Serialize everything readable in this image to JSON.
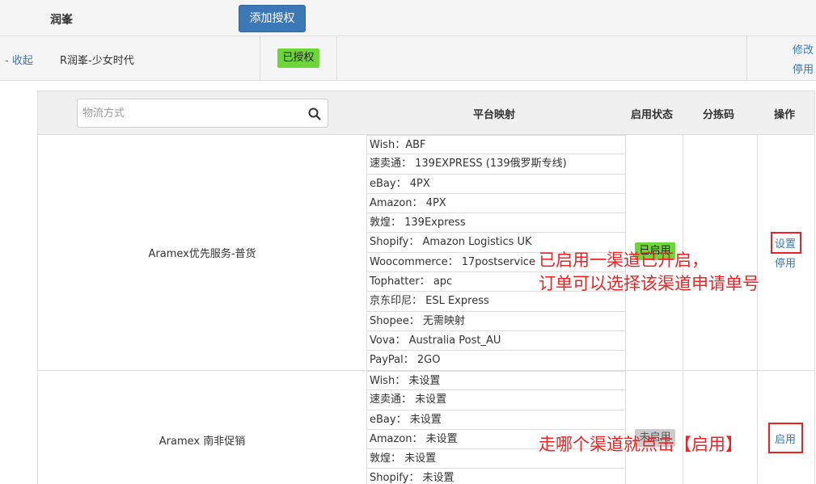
{
  "header": {
    "title": "润峯",
    "add_auth_button": "添加授权"
  },
  "account": {
    "collapse": "- 收起",
    "name": "R润峯-少女时代",
    "status": "已授权",
    "actions": [
      "修改",
      "停用"
    ]
  },
  "table": {
    "search_placeholder": "物流方式",
    "columns": {
      "mapping": "平台映射",
      "status": "启用状态",
      "sort_code": "分拣码",
      "ops": "操作"
    },
    "rows": [
      {
        "name": "Aramex优先服务-普货",
        "mappings": [
          "Wish：ABF",
          "速卖通： 139EXPRESS (139俄罗斯专线)",
          "eBay： 4PX",
          "Amazon： 4PX",
          "敦煌： 139Express",
          "Shopify： Amazon Logistics UK",
          "Woocommerce： 17postservice",
          "Tophatter： apc",
          "京东印尼： ESL Express",
          "Shopee： 无需映射",
          "Vova： Australia Post_AU",
          "PayPal： 2GO"
        ],
        "status": "已启用",
        "status_active": true,
        "actions": [
          "设置",
          "停用"
        ]
      },
      {
        "name": "Aramex 南非促销",
        "mappings": [
          "Wish： 未设置",
          "速卖通： 未设置",
          "eBay： 未设置",
          "Amazon： 未设置",
          "敦煌： 未设置",
          "Shopify： 未设置"
        ],
        "status": "未启用",
        "status_active": false,
        "actions": [
          "启用"
        ]
      }
    ]
  },
  "annotations": {
    "enabled_line1": "已启用一渠道已开启，",
    "enabled_line2": "订单可以选择该渠道申请单号",
    "click_enable": "走哪个渠道就点击【启用】"
  },
  "colors": {
    "accent": "#3a78b7",
    "enabled": "#6fd63a",
    "annotation": "#e22222"
  }
}
